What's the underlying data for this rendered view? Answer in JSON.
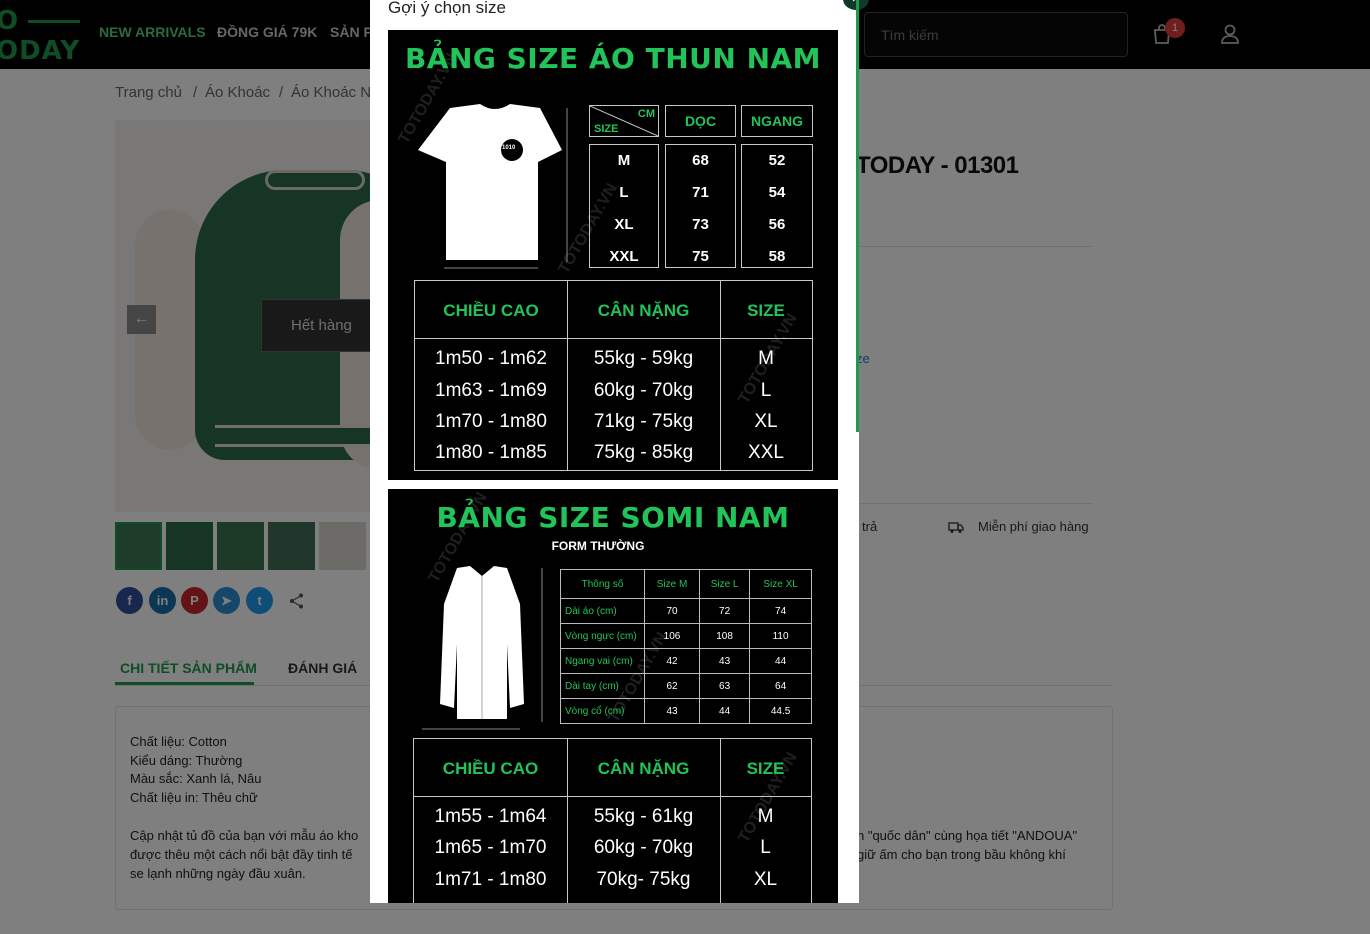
{
  "header": {
    "logo_line1": "O",
    "logo_line2": "ODAY",
    "nav": [
      "NEW ARRIVALS",
      "ĐỒNG GIÁ 79K",
      "SẢN P"
    ],
    "search_placeholder": "Tìm kiếm",
    "cart_count": "1"
  },
  "breadcrumb": [
    "Trang chủ",
    "/",
    "Áo Khoác",
    "/",
    "Áo Khoác N"
  ],
  "gallery": {
    "soldout_label": "Hết hàng",
    "prev_icon": "←"
  },
  "share": {
    "facebook": "f",
    "linkedin": "in",
    "pinterest": "P",
    "telegram": "➤",
    "twitter": "t"
  },
  "tabs": [
    "CHI TIẾT SẢN PHẨM",
    "ĐÁNH GIÁ"
  ],
  "description": {
    "lines": [
      "Chất liệu: Cotton",
      "Kiểu dáng: Thường",
      "Màu sắc: Xanh lá, Nâu",
      "Chất liệu in: Thêu chữ"
    ],
    "para_left": [
      "Cập nhật tủ đồ của bạn với mẫu áo kho",
      "được thêu một cách nổi bật đầy tinh tế",
      "se lạnh những ngày đầu xuân."
    ],
    "para_right": [
      "n \"quốc dân\" cùng họa tiết \"ANDOUA\"",
      "giữ ấm cho bạn trong bầu không khí"
    ]
  },
  "product": {
    "title_partial": "TODAY - 01301",
    "size_link_partial": "ze",
    "policy_return_partial": "trả",
    "policy_shipping": "Miễn phí giao hàng"
  },
  "modal": {
    "title": "Gợi ý chọn size",
    "close_icon": "×",
    "tshirt_chart": {
      "title": "BẢNG SIZE ÁO THUN NAM",
      "corner_cm": "CM",
      "corner_size": "SIZE",
      "col_doc": "DỌC",
      "col_ngang": "NGANG",
      "sizes": [
        "M",
        "L",
        "XL",
        "XXL"
      ],
      "doc": [
        "68",
        "71",
        "73",
        "75"
      ],
      "ngang": [
        "52",
        "54",
        "56",
        "58"
      ],
      "logo": "1010",
      "rec_headers": [
        "CHIỀU CAO",
        "CÂN NẶNG",
        "SIZE"
      ],
      "rec_rows": [
        [
          "1m50 - 1m62",
          "55kg - 59kg",
          "M"
        ],
        [
          "1m63 - 1m69",
          "60kg - 70kg",
          "L"
        ],
        [
          "1m70 - 1m80",
          "71kg - 75kg",
          "XL"
        ],
        [
          "1m80 - 1m85",
          "75kg - 85kg",
          "XXL"
        ]
      ]
    },
    "shirt_chart": {
      "title": "BẢNG SIZE SOMI NAM",
      "subtitle": "FORM THƯỜNG",
      "table_header": [
        "Thông số",
        "Size M",
        "Size L",
        "Size XL"
      ],
      "table_rows": [
        [
          "Dài áo (cm)",
          "70",
          "72",
          "74"
        ],
        [
          "Vòng ngực (cm)",
          "106",
          "108",
          "110"
        ],
        [
          "Ngang vai (cm)",
          "42",
          "43",
          "44"
        ],
        [
          "Dài tay (cm)",
          "62",
          "63",
          "64"
        ],
        [
          "Vòng cổ (cm)",
          "43",
          "44",
          "44.5"
        ]
      ],
      "rec_headers": [
        "CHIỀU CAO",
        "CÂN NẶNG",
        "SIZE"
      ],
      "rec_rows": [
        [
          "1m55 - 1m64",
          "55kg - 61kg",
          "M"
        ],
        [
          "1m65 - 1m70",
          "60kg - 70kg",
          "L"
        ],
        [
          "1m71 - 1m80",
          "70kg- 75kg",
          "XL"
        ]
      ]
    },
    "watermark": "TOTODAY.VN"
  },
  "colors": {
    "accent": "#1f9a4c",
    "chart_green": "#22c45a",
    "badge": "#e03b3b"
  }
}
